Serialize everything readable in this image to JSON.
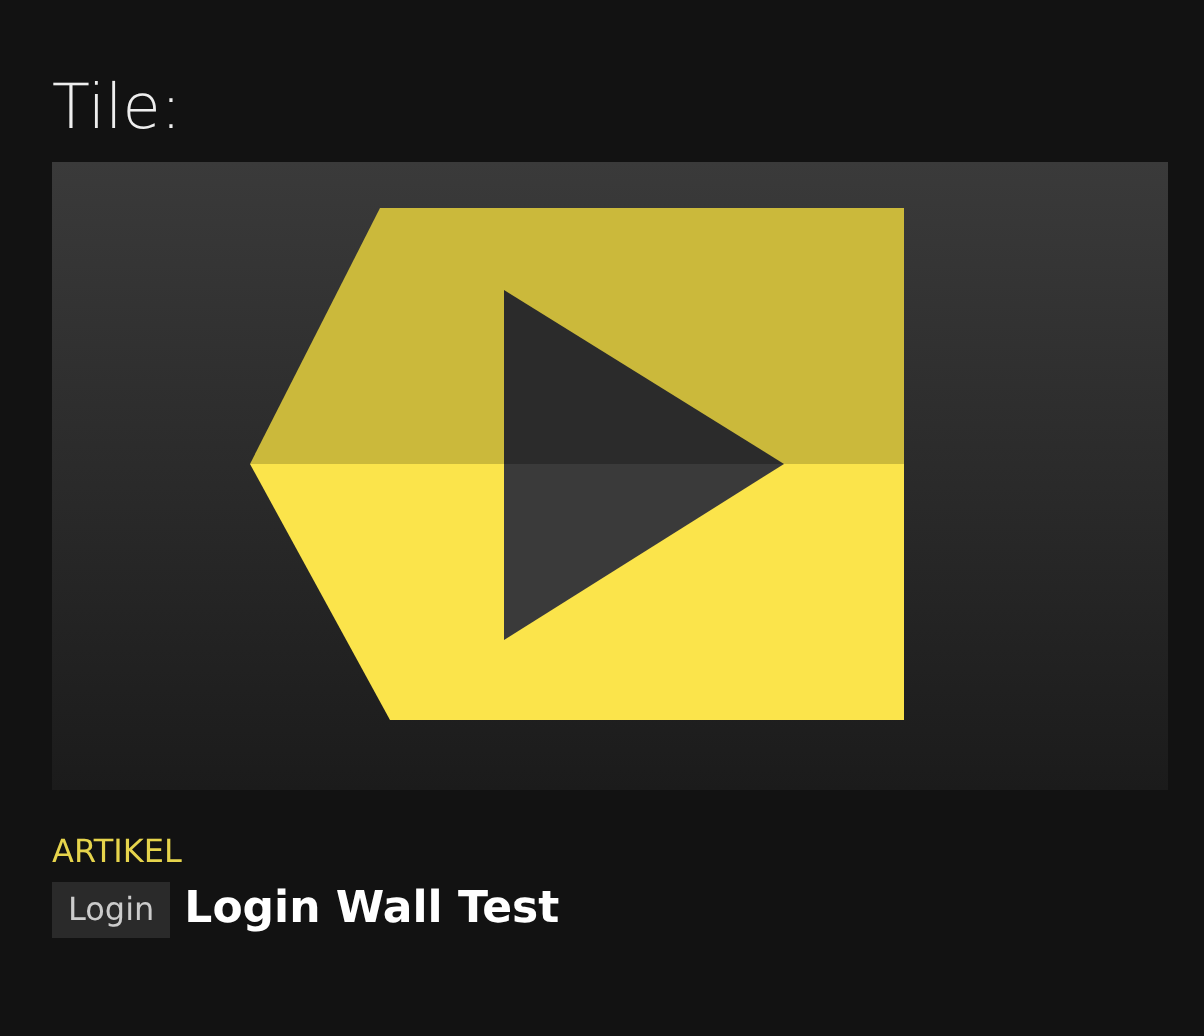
{
  "heading": "Tile:",
  "tile": {
    "category": "ARTIKEL",
    "badge": "Login",
    "title": "Login Wall Test"
  }
}
